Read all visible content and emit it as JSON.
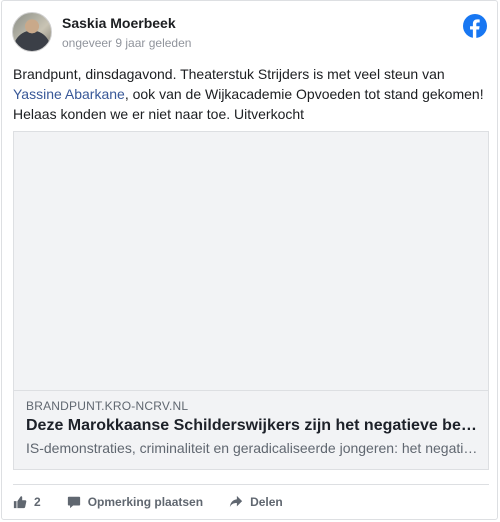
{
  "post": {
    "author": "Saskia Moerbeek",
    "timestamp": "ongeveer 9 jaar geleden",
    "text_before_link": "Brandpunt, dinsdagavond. Theaterstuk Strijders is met veel steun van ",
    "mention": "Yassine Abarkane",
    "text_after_link": ", ook van de Wijkacademie Opvoeden tot stand gekomen! Helaas konden we er niet naar toe. Uitverkocht"
  },
  "link_preview": {
    "domain": "BRANDPUNT.KRO-NCRV.NL",
    "title": "Deze Marokkaanse Schilderswijkers zijn het negatieve beeld zat",
    "description": "IS-demonstraties, criminaliteit en geradicaliseerde jongeren: het negatieve beeld"
  },
  "actions": {
    "like_count": "2",
    "comment_label": "Opmerking plaatsen",
    "share_label": "Delen"
  },
  "colors": {
    "facebook_blue": "#1877f2",
    "link": "#385898",
    "muted": "#90949c"
  }
}
